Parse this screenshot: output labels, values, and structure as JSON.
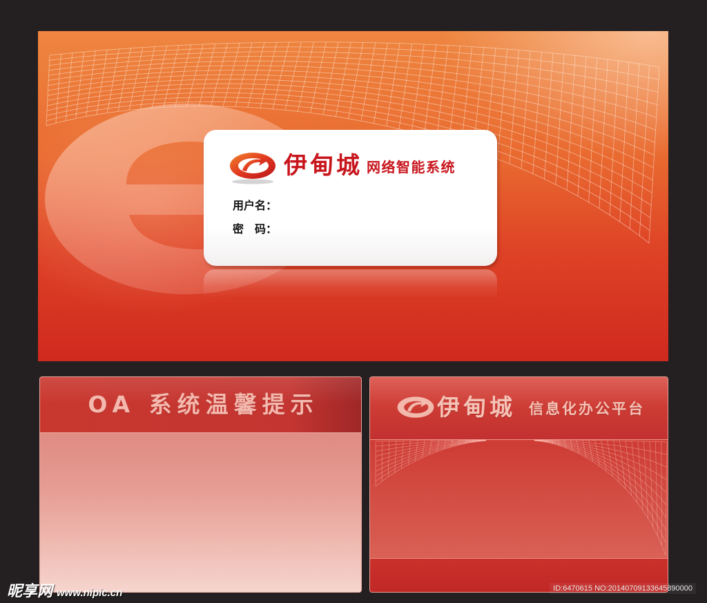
{
  "colors": {
    "page_background": "#241f20",
    "brand_red": "#c8161d",
    "panel_orange": "#ee8640",
    "panel_red": "#d0291f",
    "soft_pink_text": "#f3b9ae"
  },
  "login_panel": {
    "background_icon": "large-e-watermark-icon",
    "logo_icon": "e-swirl-logo-icon",
    "brand_name": "伊甸城",
    "brand_subtitle": "网络智能系统",
    "username_label": "用户名：",
    "password_label": "密　码："
  },
  "notice_panel": {
    "title": "OA 系统温馨提示"
  },
  "platform_panel": {
    "logo_icon": "e-swirl-logo-icon",
    "brand_name": "伊甸城",
    "brand_subtitle": "信息化办公平台"
  },
  "watermark": {
    "site_name": "昵享网",
    "site_url": "www.nipic.cn",
    "id_text": "ID:6470615 NO:20140709133645890000"
  }
}
